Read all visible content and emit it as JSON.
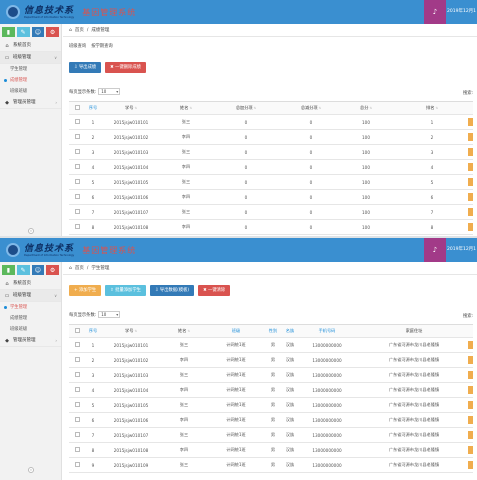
{
  "app": {
    "logo_cn": "信息技术系",
    "logo_en": "Department of Information Technology",
    "system_name": "基因管理系统",
    "date": "2019年12月1",
    "sidebar_squares": [
      {
        "color": "#5cb85c",
        "icon": "signal-icon",
        "glyph": "▮"
      },
      {
        "color": "#5bc0de",
        "icon": "pencil-icon",
        "glyph": "✎"
      },
      {
        "color": "#337ab7",
        "icon": "users-icon",
        "glyph": "☺"
      },
      {
        "color": "#d9534f",
        "icon": "cogs-icon",
        "glyph": "⚙"
      }
    ]
  },
  "panel1": {
    "sidebar": {
      "home": "系统首页",
      "section": "班级管理",
      "subitems": [
        "学生管理",
        "成绩管理",
        "班级班级"
      ],
      "active_index": 1,
      "other": "管理员管理"
    },
    "breadcrumb": {
      "home": "首页",
      "sep": "/",
      "current": "成绩管理"
    },
    "subtabs": [
      "班级查询",
      "按学期查询"
    ],
    "buttons": [
      {
        "label": "导出成绩",
        "color": "#337ab7",
        "icon": "download-icon"
      },
      {
        "label": "一键删除成绩",
        "color": "#d9534f",
        "icon": "trash-icon"
      }
    ],
    "page_size_label": "每页显示条数:",
    "page_size": "10",
    "search_label": "搜索:",
    "columns": [
      "序号",
      "学号",
      "姓名",
      "总加分项",
      "总减分项",
      "总分",
      "排名"
    ],
    "rows": [
      [
        "1",
        "2015jsjw010101",
        "张三",
        "0",
        "0",
        "100",
        "1"
      ],
      [
        "2",
        "2015jsjw010102",
        "李四",
        "0",
        "0",
        "100",
        "2"
      ],
      [
        "3",
        "2015jsjw010103",
        "张三",
        "0",
        "0",
        "100",
        "3"
      ],
      [
        "4",
        "2015jsjw010104",
        "李四",
        "0",
        "0",
        "100",
        "4"
      ],
      [
        "5",
        "2015jsjw010105",
        "张三",
        "0",
        "0",
        "100",
        "5"
      ],
      [
        "6",
        "2015jsjw010106",
        "李四",
        "0",
        "0",
        "100",
        "6"
      ],
      [
        "7",
        "2015jsjw010107",
        "张三",
        "0",
        "0",
        "100",
        "7"
      ],
      [
        "8",
        "2015jsjw010108",
        "李四",
        "0",
        "0",
        "100",
        "8"
      ]
    ]
  },
  "panel2": {
    "sidebar": {
      "home": "系统首页",
      "section": "班级管理",
      "subitems": [
        "学生管理",
        "成绩管理",
        "班级班级"
      ],
      "active_index": 0,
      "other": "管理员管理"
    },
    "breadcrumb": {
      "home": "首页",
      "sep": "/",
      "current": "学生管理"
    },
    "buttons": [
      {
        "label": "添加学生",
        "color": "#f0ad4e",
        "icon": "plus-icon"
      },
      {
        "label": "批量添加学生",
        "color": "#5bc0de",
        "icon": "upload-icon"
      },
      {
        "label": "导出数据(模板)",
        "color": "#337ab7",
        "icon": "download-icon"
      },
      {
        "label": "一键清除",
        "color": "#d9534f",
        "icon": "trash-icon"
      }
    ],
    "page_size_label": "每页显示条数:",
    "page_size": "10",
    "search_label": "搜索:",
    "columns": [
      "序号",
      "学号",
      "姓名",
      "班级",
      "性别",
      "名族",
      "手机号码",
      "家庭住址"
    ],
    "rows": [
      [
        "1",
        "2015jsjw010101",
        "张三",
        "计网统1班",
        "男",
        "汉族",
        "13000000000",
        "广东省河源市龙川县老隆镇"
      ],
      [
        "2",
        "2015jsjw010102",
        "李四",
        "计网统1班",
        "男",
        "汉族",
        "13000000000",
        "广东省河源市龙川县老隆镇"
      ],
      [
        "3",
        "2015jsjw010103",
        "张三",
        "计网统1班",
        "男",
        "汉族",
        "13000000000",
        "广东省河源市龙川县老隆镇"
      ],
      [
        "4",
        "2015jsjw010104",
        "李四",
        "计网统1班",
        "男",
        "汉族",
        "13000000000",
        "广东省河源市龙川县老隆镇"
      ],
      [
        "5",
        "2015jsjw010105",
        "张三",
        "计网统1班",
        "男",
        "汉族",
        "13000000000",
        "广东省河源市龙川县老隆镇"
      ],
      [
        "6",
        "2015jsjw010106",
        "李四",
        "计网统1班",
        "男",
        "汉族",
        "13000000000",
        "广东省河源市龙川县老隆镇"
      ],
      [
        "7",
        "2015jsjw010107",
        "张三",
        "计网统1班",
        "男",
        "汉族",
        "13000000000",
        "广东省河源市龙川县老隆镇"
      ],
      [
        "8",
        "2015jsjw010108",
        "李四",
        "计网统1班",
        "男",
        "汉族",
        "13000000000",
        "广东省河源市龙川县老隆镇"
      ],
      [
        "9",
        "2015jsjw010109",
        "张三",
        "计网统1班",
        "男",
        "汉族",
        "13000000000",
        "广东省河源市龙川县老隆镇"
      ]
    ]
  }
}
